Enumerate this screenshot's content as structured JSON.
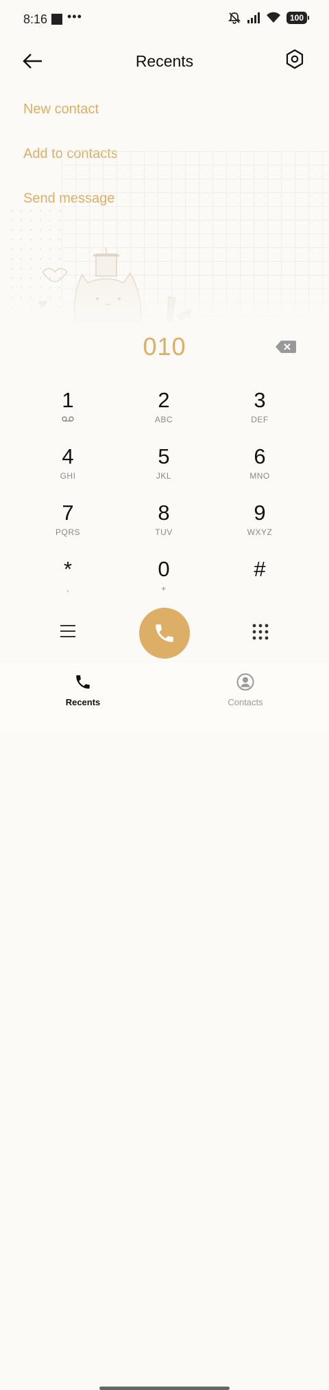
{
  "status_bar": {
    "time": "8:16",
    "dots": "•••",
    "battery": "100"
  },
  "header": {
    "title": "Recents"
  },
  "menu": {
    "new_contact": "New contact",
    "add_to_contacts": "Add to contacts",
    "send_message": "Send message"
  },
  "dialer": {
    "number": "010"
  },
  "keypad": [
    {
      "digit": "1",
      "letters": ""
    },
    {
      "digit": "2",
      "letters": "ABC"
    },
    {
      "digit": "3",
      "letters": "DEF"
    },
    {
      "digit": "4",
      "letters": "GHI"
    },
    {
      "digit": "5",
      "letters": "JKL"
    },
    {
      "digit": "6",
      "letters": "MNO"
    },
    {
      "digit": "7",
      "letters": "PQRS"
    },
    {
      "digit": "8",
      "letters": "TUV"
    },
    {
      "digit": "9",
      "letters": "WXYZ"
    },
    {
      "digit": "*",
      "letters": ","
    },
    {
      "digit": "0",
      "letters": "+"
    },
    {
      "digit": "#",
      "letters": ""
    }
  ],
  "bottom_nav": {
    "recents": "Recents",
    "contacts": "Contacts"
  },
  "colors": {
    "accent": "#dcae66",
    "background": "#fbfaf7",
    "text": "#111111"
  },
  "icons": {
    "back": "arrow-left-icon",
    "settings": "hexagon-gear-icon",
    "backspace": "backspace-icon",
    "voicemail": "voicemail-icon",
    "menu": "hamburger-icon",
    "call": "phone-icon",
    "dialpad": "dialpad-icon",
    "recents": "phone-icon",
    "contacts": "person-circle-icon"
  }
}
